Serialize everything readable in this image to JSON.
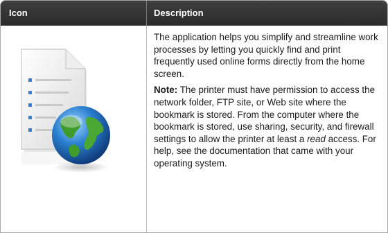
{
  "table": {
    "headers": {
      "icon": "Icon",
      "description": "Description"
    },
    "row": {
      "icon_name": "web-bookmark-document-globe-icon",
      "description": "The application helps you simplify and streamline work processes by letting you quickly find and print frequently used online forms directly from the home screen.",
      "note_label": "Note:",
      "note_text_before": " The printer must have permission to access the network folder, FTP site, or Web site where the bookmark is stored. From the computer where the bookmark is stored, use sharing, security, and firewall settings to allow the printer at least a ",
      "note_emphasis": "read",
      "note_text_after": " access. For help, see the documentation that came with your operating system."
    }
  },
  "colors": {
    "header_bg": "#333333",
    "header_text": "#ffffff",
    "border": "#a8a8a8"
  }
}
